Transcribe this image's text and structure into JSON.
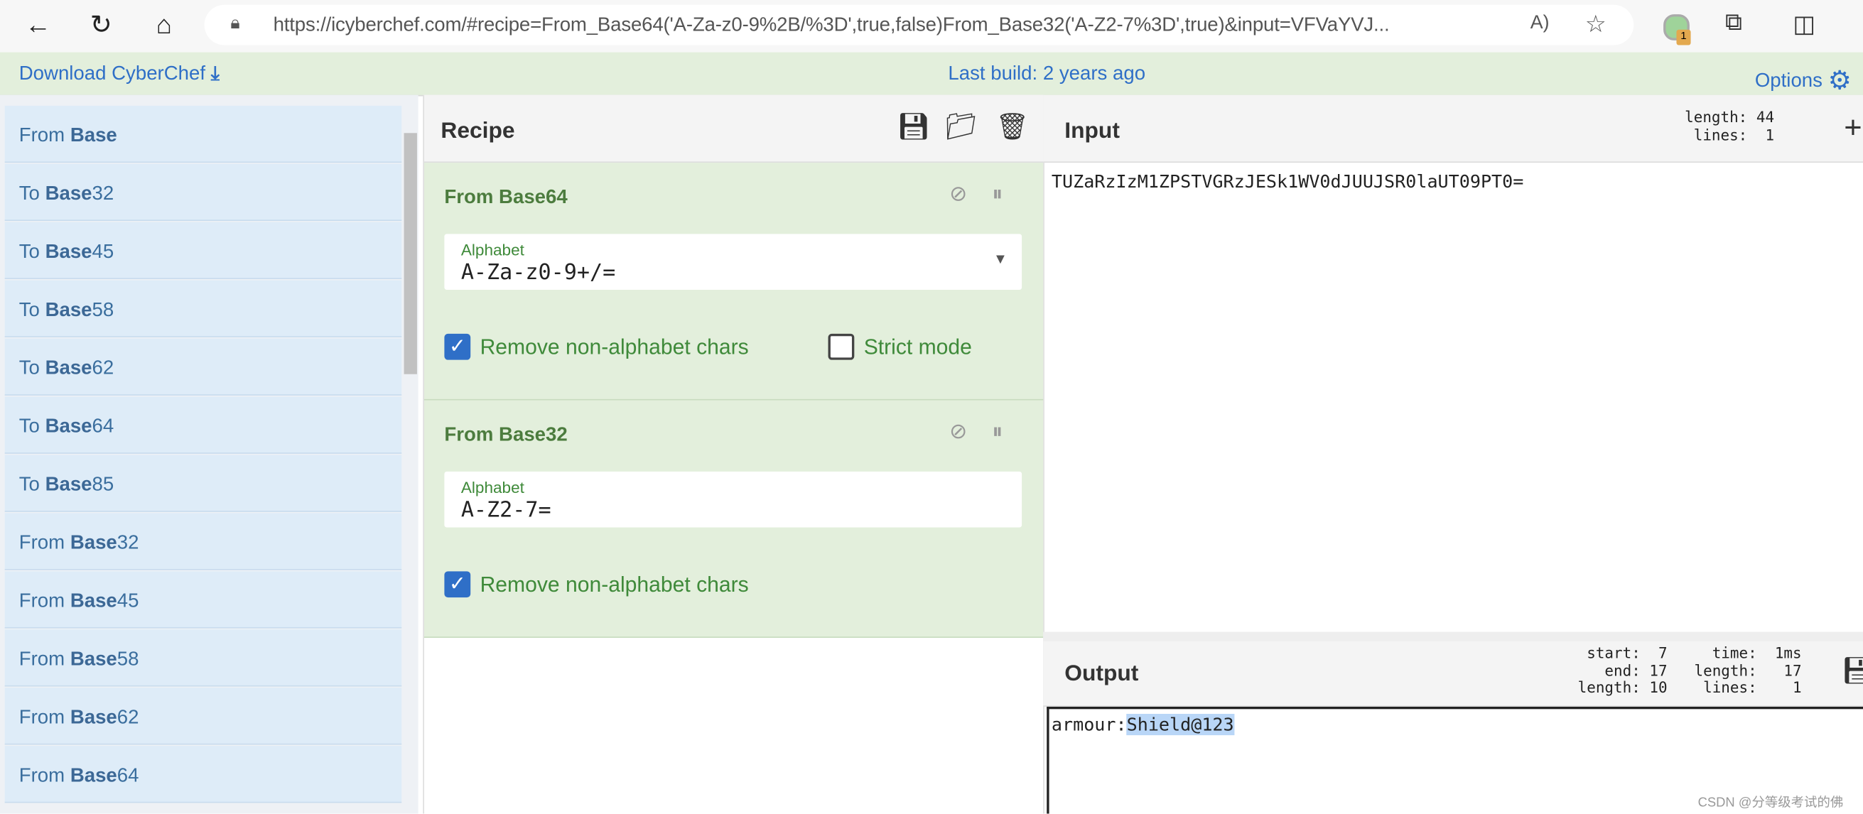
{
  "browser": {
    "url": "https://icyberchef.com/#recipe=From_Base64('A-Za-z0-9%2B/%3D',true,false)From_Base32('A-Z2-7%3D',true)&input=VFVaYVJ...",
    "extension_badge": "1"
  },
  "banner": {
    "download": "Download CyberChef",
    "last_build": "Last build: 2 years ago",
    "options": "Options"
  },
  "operations": [
    {
      "prefix": "From ",
      "bold": "Base",
      "suffix": ""
    },
    {
      "prefix": "To ",
      "bold": "Base",
      "suffix": "32"
    },
    {
      "prefix": "To ",
      "bold": "Base",
      "suffix": "45"
    },
    {
      "prefix": "To ",
      "bold": "Base",
      "suffix": "58"
    },
    {
      "prefix": "To ",
      "bold": "Base",
      "suffix": "62"
    },
    {
      "prefix": "To ",
      "bold": "Base",
      "suffix": "64"
    },
    {
      "prefix": "To ",
      "bold": "Base",
      "suffix": "85"
    },
    {
      "prefix": "From ",
      "bold": "Base",
      "suffix": "32"
    },
    {
      "prefix": "From ",
      "bold": "Base",
      "suffix": "45"
    },
    {
      "prefix": "From ",
      "bold": "Base",
      "suffix": "58"
    },
    {
      "prefix": "From ",
      "bold": "Base",
      "suffix": "62"
    },
    {
      "prefix": "From ",
      "bold": "Base",
      "suffix": "64"
    }
  ],
  "recipe": {
    "title": "Recipe",
    "ops": [
      {
        "title": "From Base64",
        "field_label": "Alphabet",
        "field_value": "A-Za-z0-9+/=",
        "check1": "Remove non-alphabet chars",
        "check1_on": true,
        "check2": "Strict mode",
        "check2_on": false
      },
      {
        "title": "From Base32",
        "field_label": "Alphabet",
        "field_value": "A-Z2-7=",
        "check1": "Remove non-alphabet chars",
        "check1_on": true
      }
    ]
  },
  "input": {
    "title": "Input",
    "stats": "length: 44\n lines:  1",
    "text": "TUZaRzIzM1ZPSTVGRzJESk1WV0dJUUJSR0laUT09PT0="
  },
  "output": {
    "title": "Output",
    "stats_left": " start:  7\n   end: 17\nlength: 10",
    "stats_right": "  time:  1ms\nlength:   17\n lines:    1",
    "text_plain": "armour:",
    "text_selected": "Shield@123",
    "watermark": "CSDN @分等级考试的佛"
  }
}
